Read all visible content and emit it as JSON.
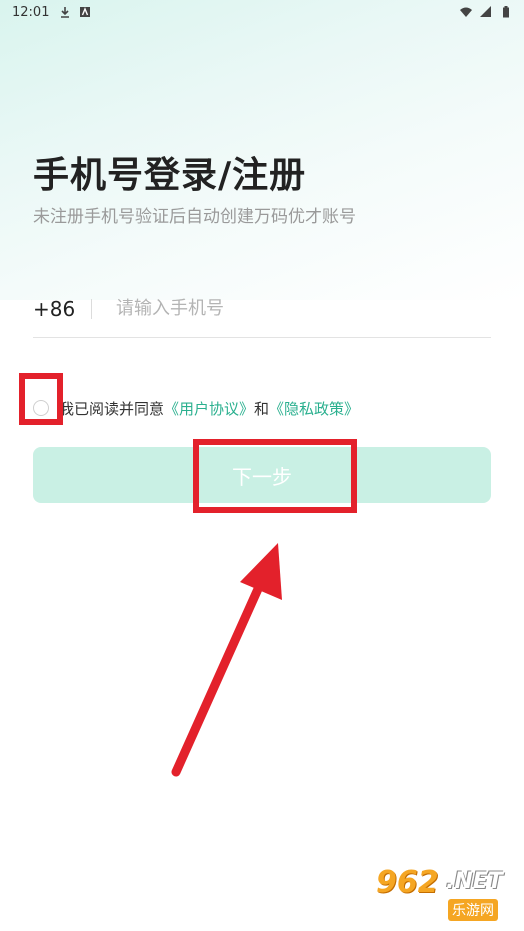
{
  "status_bar": {
    "time": "12:01"
  },
  "login": {
    "title": "手机号登录/注册",
    "subtitle": "未注册手机号验证后自动创建万码优才账号",
    "country_code": "+86",
    "phone_placeholder": "请输入手机号",
    "phone_value": ""
  },
  "agreement": {
    "prefix": "我已阅读并同意",
    "user_agreement": "《用户协议》",
    "conjunction": "和",
    "privacy_policy": "《隐私政策》",
    "checked": false
  },
  "next_button": {
    "label": "下一步"
  },
  "watermark": {
    "number": "962",
    "net": ".NET",
    "sub": "乐游网"
  },
  "colors": {
    "accent": "#2bb08f",
    "button_bg": "#c9f0e4",
    "highlight": "#e3212b"
  }
}
